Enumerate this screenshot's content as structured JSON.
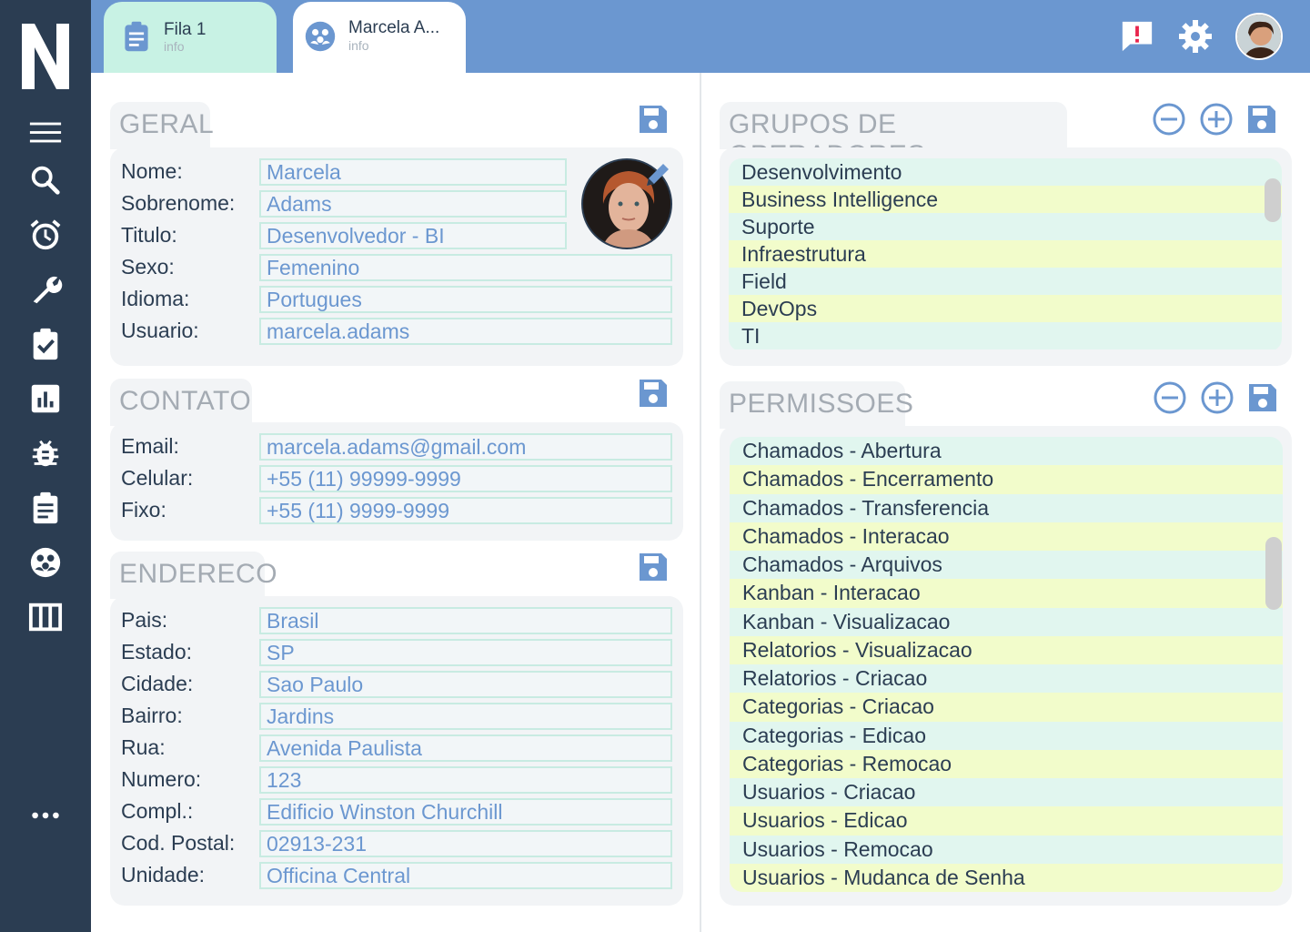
{
  "app": {
    "logo_letter": "N"
  },
  "sidebar": {
    "items": [
      {
        "name": "menu",
        "icon": "menu-icon"
      },
      {
        "name": "search",
        "icon": "search-icon"
      },
      {
        "name": "alarm",
        "icon": "alarm-clock-icon"
      },
      {
        "name": "tools",
        "icon": "wrench-icon"
      },
      {
        "name": "tasks",
        "icon": "clipboard-check-icon"
      },
      {
        "name": "reports",
        "icon": "bar-chart-icon"
      },
      {
        "name": "bugs",
        "icon": "bug-icon"
      },
      {
        "name": "assignments",
        "icon": "clipboard-list-icon"
      },
      {
        "name": "groups",
        "icon": "group-icon"
      },
      {
        "name": "columns",
        "icon": "columns-icon"
      },
      {
        "name": "more",
        "icon": "more-dots-icon"
      }
    ]
  },
  "tabs": [
    {
      "title": "Fila 1",
      "subtitle": "info",
      "icon": "clipboard-icon"
    },
    {
      "title": "Marcela A...",
      "subtitle": "info",
      "icon": "group-icon"
    }
  ],
  "topbar": {
    "alert_icon": "alert-message-icon",
    "settings_icon": "gear-icon"
  },
  "geral": {
    "title": "GERAL",
    "labels": [
      "Nome:",
      "Sobrenome:",
      "Titulo:",
      "Sexo:",
      "Idioma:",
      "Usuario:"
    ],
    "values": [
      "Marcela",
      "Adams",
      "Desenvolvedor - BI",
      "Femenino",
      "Portugues",
      "marcela.adams"
    ]
  },
  "contato": {
    "title": "CONTATO",
    "labels": [
      "Email:",
      "Celular:",
      "Fixo:"
    ],
    "values": [
      "marcela.adams@gmail.com",
      "+55 (11) 99999-9999",
      "+55 (11) 9999-9999"
    ]
  },
  "endereco": {
    "title": "ENDERECO",
    "labels": [
      "Pais:",
      "Estado:",
      "Cidade:",
      "Bairro:",
      "Rua:",
      "Numero:",
      "Compl.:",
      "Cod. Postal:",
      "Unidade:"
    ],
    "values": [
      "Brasil",
      "SP",
      "Sao Paulo",
      "Jardins",
      "Avenida Paulista",
      "123",
      "Edificio Winston Churchill",
      "02913-231",
      "Officina Central"
    ]
  },
  "grupos": {
    "title": "GRUPOS DE OPERADORES",
    "items": [
      "Desenvolvimento",
      "Business Intelligence",
      "Suporte",
      "Infraestrutura",
      "Field",
      "DevOps",
      "TI"
    ]
  },
  "permissoes": {
    "title": "PERMISSOES",
    "items": [
      "Chamados - Abertura",
      "Chamados - Encerramento",
      "Chamados - Transferencia",
      "Chamados - Interacao",
      "Chamados - Arquivos",
      "Kanban - Interacao",
      "Kanban - Visualizacao",
      "Relatorios - Visualizacao",
      "Relatorios - Criacao",
      "Categorias - Criacao",
      "Categorias - Edicao",
      "Categorias - Remocao",
      "Usuarios - Criacao",
      "Usuarios - Edicao",
      "Usuarios - Remocao",
      "Usuarios - Mudanca de Senha"
    ]
  },
  "colors": {
    "sidebar": "#2b3d52",
    "topbar": "#6b97d0",
    "accent": "#6b97d0",
    "alert": "#e8254d",
    "row_a": "#e1f6ef",
    "row_b": "#f2fccb"
  }
}
